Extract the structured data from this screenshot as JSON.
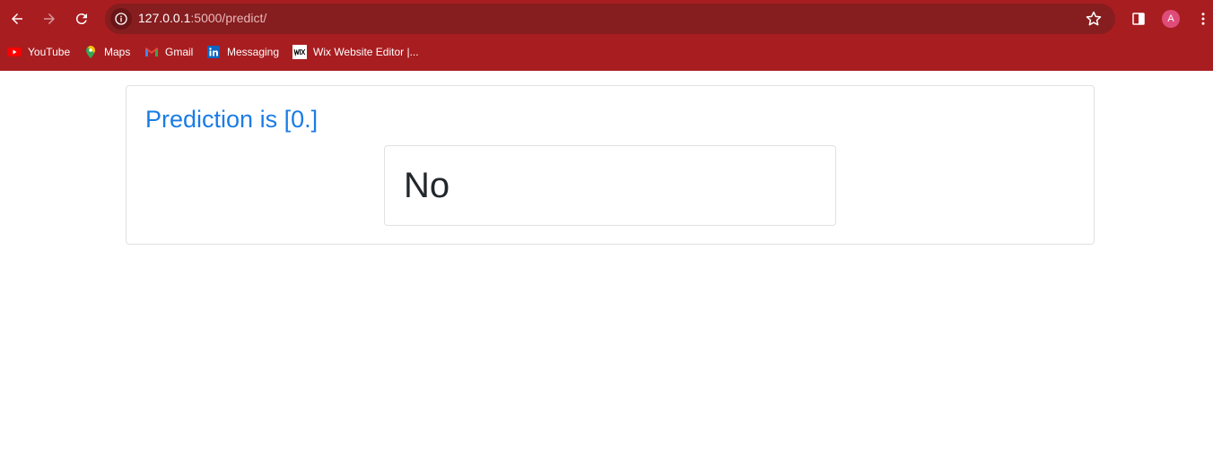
{
  "browser": {
    "url_host": "127.0.0.1",
    "url_path": ":5000/predict/",
    "profile_initial": "A",
    "icons": {
      "back": "back-arrow-icon",
      "forward": "forward-arrow-icon",
      "reload": "reload-icon",
      "site_info": "info-icon",
      "bookmark_star": "star-icon",
      "side_panel": "side-panel-icon",
      "menu": "kebab-menu-icon"
    }
  },
  "bookmarks": [
    {
      "label": "YouTube",
      "icon": "youtube-icon"
    },
    {
      "label": "Maps",
      "icon": "maps-icon"
    },
    {
      "label": "Gmail",
      "icon": "gmail-icon"
    },
    {
      "label": "Messaging",
      "icon": "linkedin-icon"
    },
    {
      "label": "Wix Website Editor |...",
      "icon": "wix-icon"
    }
  ],
  "page": {
    "title": "Prediction is [0.]",
    "result": "No"
  },
  "colors": {
    "chrome": "#a81d20",
    "omnibox": "#861d1f",
    "title": "#1a7ce6",
    "result_text": "#22272b"
  }
}
